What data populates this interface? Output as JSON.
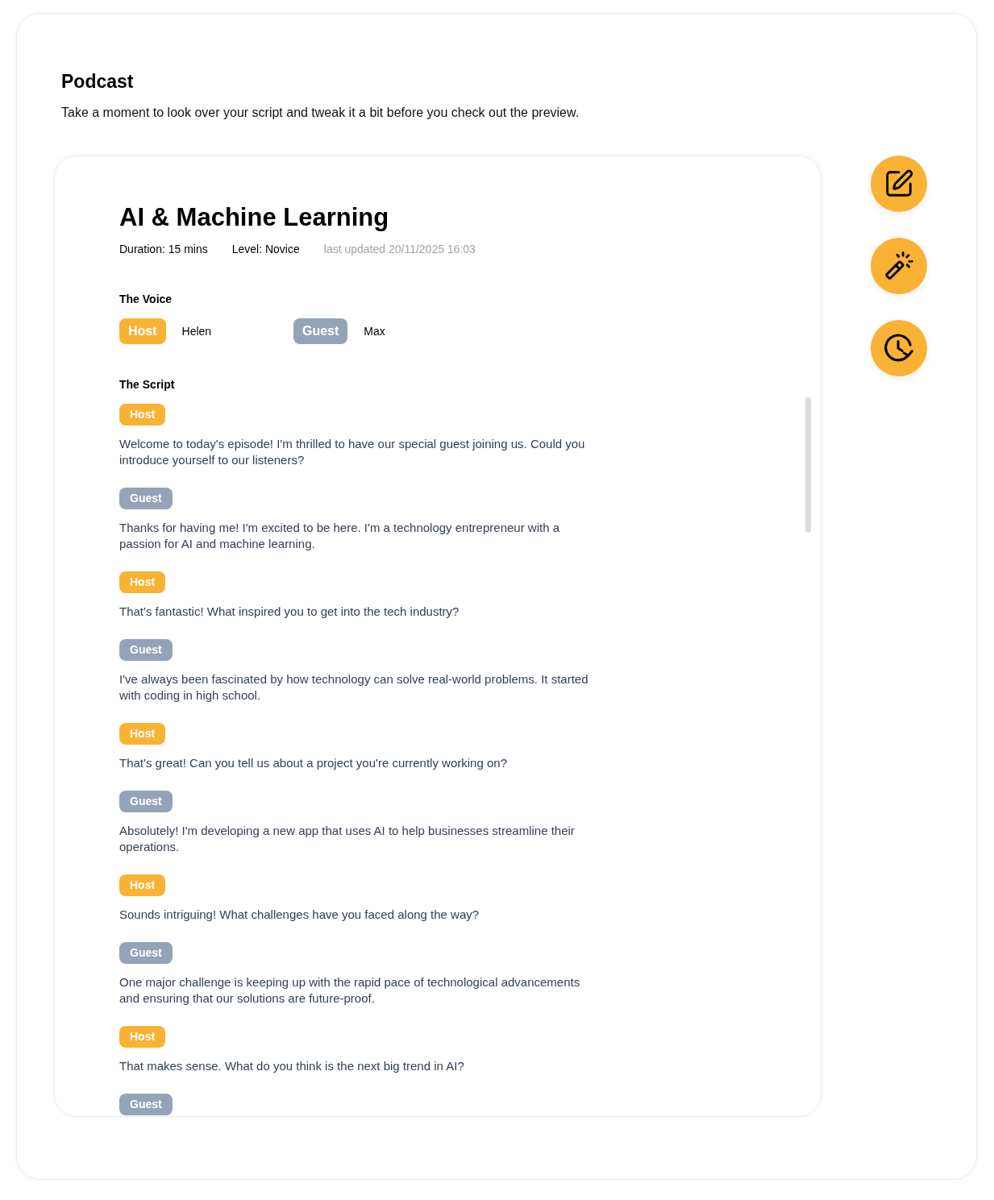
{
  "page": {
    "title": "Podcast",
    "subtitle": "Take a moment to look over your script and tweak it a bit before you check out the preview."
  },
  "episode": {
    "title": "AI & Machine Learning",
    "duration": "Duration: 15 mins",
    "level": "Level: Novice",
    "last_updated": "last updated 20/11/2025 16:03"
  },
  "voice": {
    "heading": "The Voice",
    "roles": [
      {
        "kind": "host",
        "label": "Host",
        "name": "Helen"
      },
      {
        "kind": "guest",
        "label": "Guest",
        "name": "Max"
      }
    ]
  },
  "script": {
    "heading": "The Script",
    "lines": [
      {
        "kind": "host",
        "speaker": "Host",
        "text": "Welcome to today's episode! I'm thrilled to have our special guest joining us. Could you introduce yourself to our listeners?"
      },
      {
        "kind": "guest",
        "speaker": "Guest",
        "text": "Thanks for having me! I'm excited to be here. I'm a technology entrepreneur with a passion for AI and machine learning."
      },
      {
        "kind": "host",
        "speaker": "Host",
        "text": "That's fantastic! What inspired you to get into the tech industry?"
      },
      {
        "kind": "guest",
        "speaker": "Guest",
        "text": "I've always been fascinated by how technology can solve real-world problems. It started with coding in high school."
      },
      {
        "kind": "host",
        "speaker": "Host",
        "text": "That's great! Can you tell us about a project you're currently working on?"
      },
      {
        "kind": "guest",
        "speaker": "Guest",
        "text": "Absolutely! I'm developing a new app that uses AI to help businesses streamline their operations."
      },
      {
        "kind": "host",
        "speaker": "Host",
        "text": "Sounds intriguing! What challenges have you faced along the way?"
      },
      {
        "kind": "guest",
        "speaker": "Guest",
        "text": "One major challenge is keeping up with the rapid pace of technological advancements and ensuring that our solutions are future-proof."
      },
      {
        "kind": "host",
        "speaker": "Host",
        "text": "That makes sense. What do you think is the next big trend in AI?"
      },
      {
        "kind": "guest",
        "speaker": "Guest"
      }
    ]
  }
}
